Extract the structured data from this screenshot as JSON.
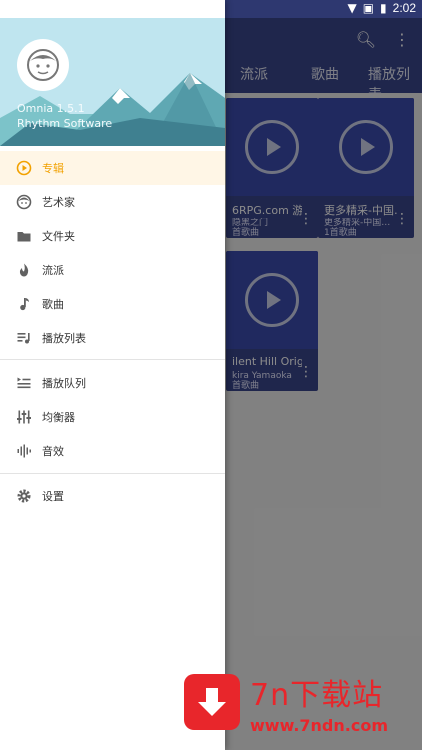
{
  "status_bar": {
    "time": "2:02"
  },
  "app": {
    "tabs": [
      "流派",
      "歌曲",
      "播放列表"
    ],
    "cards": [
      {
        "title": "6RPG.com 游…",
        "subtitle": "隐黑之门",
        "count": "首歌曲"
      },
      {
        "title": "更多精采-中国…",
        "subtitle": "更多精采-中国…",
        "count": "1首歌曲"
      },
      {
        "title": "ilent Hill Origin…",
        "subtitle": "kira Yamaoka",
        "count": "首歌曲"
      }
    ]
  },
  "drawer": {
    "app_name": "Omnia 1.5.1",
    "publisher": "Rhythm Software",
    "menu_primary": [
      {
        "label": "专辑",
        "icon": "album-icon",
        "selected": true
      },
      {
        "label": "艺术家",
        "icon": "artist-icon",
        "selected": false
      },
      {
        "label": "文件夹",
        "icon": "folder-icon",
        "selected": false
      },
      {
        "label": "流派",
        "icon": "genre-flame-icon",
        "selected": false
      },
      {
        "label": "歌曲",
        "icon": "music-note-icon",
        "selected": false
      },
      {
        "label": "播放列表",
        "icon": "playlist-icon",
        "selected": false
      }
    ],
    "menu_secondary": [
      {
        "label": "播放队列",
        "icon": "queue-icon"
      },
      {
        "label": "均衡器",
        "icon": "equalizer-icon"
      },
      {
        "label": "音效",
        "icon": "sound-effects-icon"
      }
    ],
    "menu_tertiary": [
      {
        "label": "设置",
        "icon": "settings-gear-icon"
      }
    ]
  },
  "watermark": {
    "brand_text": "7n下载站",
    "url": "www.7ndn.com"
  },
  "colors": {
    "accent": "#f2a100",
    "primary": "#3a458a",
    "watermark_red": "#e8262b"
  }
}
